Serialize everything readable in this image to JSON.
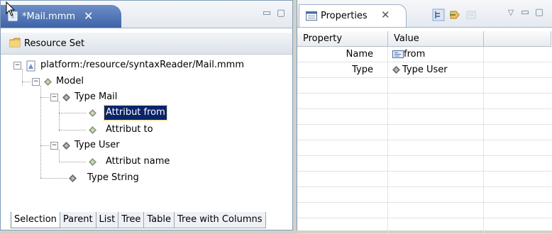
{
  "editor": {
    "tab_label": "*Mail.mmm",
    "tab_close": "✕",
    "min_glyph": "▭",
    "max_glyph": "▢"
  },
  "resource_bar": {
    "label": "Resource Set"
  },
  "tree": {
    "root": "platform:/resource/syntaxReader/Mail.mmm",
    "model": "Model",
    "type_mail": "Type Mail",
    "attr_from": "Attribut from",
    "attr_to": "Attribut to",
    "type_user": "Type User",
    "attr_name": "Attribut name",
    "type_string": "Type String"
  },
  "bottom_tabs": [
    "Selection",
    "Parent",
    "List",
    "Tree",
    "Table",
    "Tree with Columns"
  ],
  "properties": {
    "tab_label": "Properties",
    "tab_close": "✕",
    "columns": [
      "Property",
      "Value"
    ],
    "rows": [
      {
        "property": "Name",
        "value": "from"
      },
      {
        "property": "Type",
        "value": "Type User"
      }
    ]
  },
  "colors": {
    "tab_active": "#3e63a8",
    "selection": "#0a246a",
    "diamond": "#8a9a78"
  }
}
